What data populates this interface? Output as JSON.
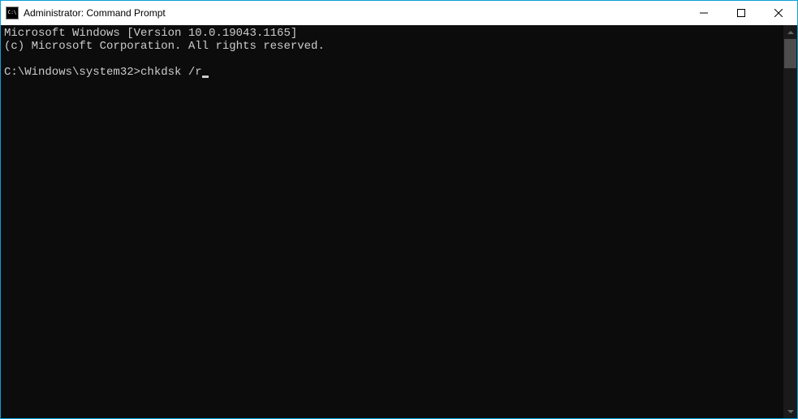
{
  "titlebar": {
    "title": "Administrator: Command Prompt"
  },
  "terminal": {
    "line1": "Microsoft Windows [Version 10.0.19043.1165]",
    "line2": "(c) Microsoft Corporation. All rights reserved.",
    "blank": "",
    "prompt": "C:\\Windows\\system32>",
    "command": "chkdsk /r"
  }
}
